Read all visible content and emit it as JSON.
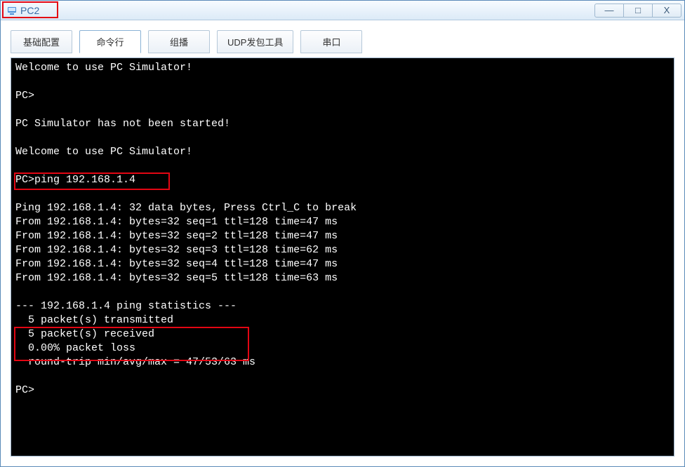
{
  "window": {
    "title": "PC2"
  },
  "win_controls": {
    "minimize": "—",
    "maximize": "□",
    "close": "X"
  },
  "tabs": [
    {
      "label": "基础配置"
    },
    {
      "label": "命令行"
    },
    {
      "label": "组播"
    },
    {
      "label": "UDP发包工具"
    },
    {
      "label": "串口"
    }
  ],
  "terminal": {
    "lines": [
      "Welcome to use PC Simulator!",
      "",
      "PC>",
      "",
      "PC Simulator has not been started!",
      "",
      "Welcome to use PC Simulator!",
      "",
      "PC>ping 192.168.1.4",
      "",
      "Ping 192.168.1.4: 32 data bytes, Press Ctrl_C to break",
      "From 192.168.1.4: bytes=32 seq=1 ttl=128 time=47 ms",
      "From 192.168.1.4: bytes=32 seq=2 ttl=128 time=47 ms",
      "From 192.168.1.4: bytes=32 seq=3 ttl=128 time=62 ms",
      "From 192.168.1.4: bytes=32 seq=4 ttl=128 time=47 ms",
      "From 192.168.1.4: bytes=32 seq=5 ttl=128 time=63 ms",
      "",
      "--- 192.168.1.4 ping statistics ---",
      "  5 packet(s) transmitted",
      "  5 packet(s) received",
      "  0.00% packet loss",
      "  round-trip min/avg/max = 47/53/63 ms",
      "",
      "PC>"
    ]
  }
}
